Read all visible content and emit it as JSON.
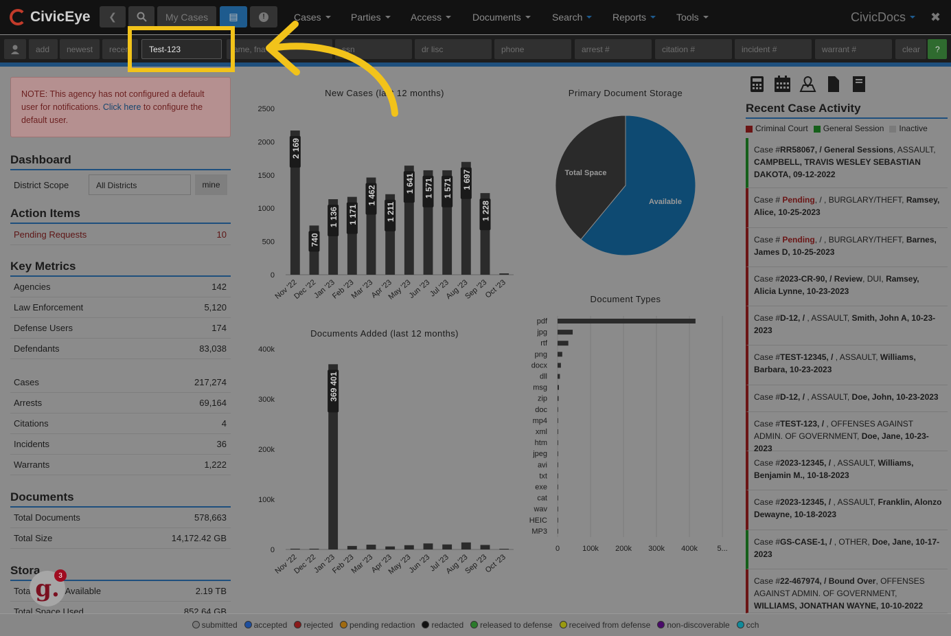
{
  "app": {
    "brand": "CivicEye",
    "right_brand": "CivicDocs"
  },
  "toolbar": {
    "my_cases_label": "My Cases"
  },
  "menu": [
    {
      "label": "Cases"
    },
    {
      "label": "Parties"
    },
    {
      "label": "Access"
    },
    {
      "label": "Documents"
    },
    {
      "label": "Search"
    },
    {
      "label": "Reports"
    },
    {
      "label": "Tools"
    }
  ],
  "searchbar": {
    "add": "add",
    "newest": "newest",
    "recent": "recen",
    "search_value": "Test-123",
    "name": "ame, fna",
    "ssn": "ssn",
    "dl": "dr lisc",
    "phone": "phone",
    "arrest": "arrest #",
    "citation": "citation #",
    "incident": "incident #",
    "warrant": "warrant #",
    "clear": "clear",
    "help": "?"
  },
  "note": {
    "text1": "NOTE: This agency has not configured a default user for notifications.",
    "link": "Click here",
    "text2": "to configure the default user."
  },
  "dashboard": {
    "title": "Dashboard",
    "district_label": "District Scope",
    "district_value": "All Districts",
    "mine_button": "mine"
  },
  "action_items": {
    "title": "Action Items",
    "items": [
      {
        "label": "Pending Requests",
        "value": "10"
      }
    ]
  },
  "key_metrics": {
    "title": "Key Metrics",
    "group1": [
      {
        "label": "Agencies",
        "value": "142"
      },
      {
        "label": "Law Enforcement",
        "value": "5,120"
      },
      {
        "label": "Defense Users",
        "value": "174"
      },
      {
        "label": "Defendants",
        "value": "83,038"
      }
    ],
    "group2": [
      {
        "label": "Cases",
        "value": "217,274"
      },
      {
        "label": "Arrests",
        "value": "69,164"
      },
      {
        "label": "Citations",
        "value": "4"
      },
      {
        "label": "Incidents",
        "value": "36"
      },
      {
        "label": "Warrants",
        "value": "1,222"
      }
    ]
  },
  "documents": {
    "title": "Documents",
    "items": [
      {
        "label": "Total Documents",
        "value": "578,663"
      },
      {
        "label": "Total Size",
        "value": "14,172.42 GB"
      }
    ]
  },
  "storage": {
    "title": "Stora",
    "items": [
      {
        "label": "Tota",
        "label2": "Available",
        "value": "2.19 TB"
      },
      {
        "label": "Total Space Used",
        "value": "852.64 GB"
      }
    ]
  },
  "notif": {
    "letter": "g.",
    "count": "3"
  },
  "chart_data": [
    {
      "type": "bar",
      "title": "New Cases (last 12 months)",
      "categories": [
        "Nov '22",
        "Dec '22",
        "Jan '23",
        "Feb '23",
        "Mar '23",
        "Apr '23",
        "May '23",
        "Jun '23",
        "Jul '23",
        "Aug '23",
        "Sep '23",
        "Oct '23"
      ],
      "values": [
        2169,
        740,
        1136,
        1171,
        1462,
        1211,
        1641,
        1571,
        1571,
        1697,
        1228,
        20
      ],
      "data_labels": [
        "2 169",
        "740",
        "1 136",
        "1 171",
        "1 462",
        "1 211",
        "1 641",
        "1 571",
        "1 571",
        "1 697",
        "1 228",
        ""
      ],
      "yticks": [
        "0",
        "500",
        "1000",
        "1500",
        "2000",
        "2500"
      ],
      "ylim": [
        0,
        2500
      ]
    },
    {
      "type": "bar",
      "title": "Documents Added (last 12 months)",
      "categories": [
        "Nov '22",
        "Dec '22",
        "Jan '23",
        "Feb '23",
        "Mar '23",
        "Apr '23",
        "May '23",
        "Jun '23",
        "Jul '23",
        "Aug '23",
        "Sep '23",
        "Oct '23"
      ],
      "values": [
        1500,
        1500,
        369401,
        7000,
        9500,
        6000,
        8500,
        12000,
        10000,
        14000,
        9000,
        0
      ],
      "data_labels": [
        "",
        "",
        "369 401",
        "",
        "",
        "",
        "",
        "",
        "",
        "",
        "",
        ""
      ],
      "yticks": [
        "0",
        "100k",
        "200k",
        "300k",
        "400k"
      ],
      "ylim": [
        0,
        400000
      ]
    },
    {
      "type": "pie",
      "title": "Primary Document Storage",
      "labels": [
        "Total Space",
        "Available"
      ],
      "values": [
        39,
        61
      ],
      "colors": [
        "#2a2a2a",
        "#0e4a72"
      ]
    },
    {
      "type": "bar",
      "orientation": "horizontal",
      "title": "Document Types",
      "categories": [
        "pdf",
        "jpg",
        "rtf",
        "png",
        "docx",
        "dll",
        "msg",
        "zip",
        "doc",
        "mp4",
        "xml",
        "htm",
        "jpeg",
        "avi",
        "txt",
        "exe",
        "cat",
        "wav",
        "HEIC",
        "MP3"
      ],
      "values": [
        410000,
        45000,
        32000,
        14000,
        10000,
        7000,
        4000,
        3000,
        1500,
        600,
        500,
        400,
        300,
        200,
        200,
        150,
        100,
        100,
        80,
        50
      ],
      "xticks": [
        "0",
        "100k",
        "200k",
        "300k",
        "400k",
        "5..."
      ],
      "xlim": [
        0,
        500000
      ]
    }
  ],
  "recent": {
    "title": "Recent Case Activity",
    "legend": [
      {
        "label": "Criminal Court",
        "color": "#6b1515"
      },
      {
        "label": "General Session",
        "color": "#155f1a"
      },
      {
        "label": "Inactive",
        "color": "#7a7a7a"
      }
    ],
    "cases": [
      {
        "type": "green",
        "p1": "Case #",
        "num": "RR58067, / General Sessions",
        "p2": ", ASSAULT, ",
        "name": "CAMPBELL, TRAVIS WESLEY SEBASTIAN DAKOTA, 09-12-2022"
      },
      {
        "type": "red",
        "p1": "Case # ",
        "pending": "Pending",
        "p2": ", / , BURGLARY/THEFT, ",
        "name": "Ramsey, Alice, 10-25-2023"
      },
      {
        "type": "red",
        "p1": "Case # ",
        "pending": "Pending",
        "p2": ", / , BURGLARY/THEFT, ",
        "name": "Barnes, James D, 10-25-2023"
      },
      {
        "type": "red",
        "p1": "Case #",
        "num": "2023-CR-90, / Review",
        "p2": ", DUI, ",
        "name": "Ramsey, Alicia Lynne, 10-23-2023"
      },
      {
        "type": "red",
        "p1": "Case #",
        "num": "D-12, / ",
        "p2": ", ASSAULT, ",
        "name": "Smith, John A, 10-23-2023"
      },
      {
        "type": "red",
        "p1": "Case #",
        "num": "TEST-12345, / ",
        "p2": ", ASSAULT, ",
        "name": "Williams, Barbara, 10-23-2023"
      },
      {
        "type": "red",
        "p1": "Case #",
        "num": "D-12, / ",
        "p2": ", ASSAULT, ",
        "name": "Doe, John, 10-23-2023"
      },
      {
        "type": "red",
        "p1": "Case #",
        "num": "TEST-123, / ",
        "p2": ", OFFENSES AGAINST ADMIN. OF GOVERNMENT, ",
        "name": "Doe, Jane, 10-23-2023"
      },
      {
        "type": "red",
        "p1": "Case #",
        "num": "2023-12345, / ",
        "p2": ", ASSAULT, ",
        "name": "Williams, Benjamin M., 10-18-2023"
      },
      {
        "type": "red",
        "p1": "Case #",
        "num": "2023-12345, / ",
        "p2": ", ASSAULT, ",
        "name": "Franklin, Alonzo Dewayne, 10-18-2023"
      },
      {
        "type": "green",
        "p1": "Case #",
        "num": "GS-CASE-1, / ",
        "p2": ", OTHER, ",
        "name": "Doe, Jane, 10-17-2023"
      },
      {
        "type": "red",
        "p1": "Case #",
        "num": "22-467974, / Bound Over",
        "p2": ", OFFENSES AGAINST ADMIN. OF GOVERNMENT, ",
        "name": "WILLIAMS, JONATHAN WAYNE, 10-10-2022"
      }
    ]
  },
  "footer_legend": [
    {
      "label": "submitted",
      "color": "#7a7a7a"
    },
    {
      "label": "accepted",
      "color": "#1e4f9e"
    },
    {
      "label": "rejected",
      "color": "#8a1a1a"
    },
    {
      "label": "pending redaction",
      "color": "#a06a10"
    },
    {
      "label": "redacted",
      "color": "#111111"
    },
    {
      "label": "released to defense",
      "color": "#2a7a2a"
    },
    {
      "label": "received from defense",
      "color": "#9a9a10"
    },
    {
      "label": "non-discoverable",
      "color": "#4a0a6a"
    },
    {
      "label": "cch",
      "color": "#108a9a"
    }
  ]
}
